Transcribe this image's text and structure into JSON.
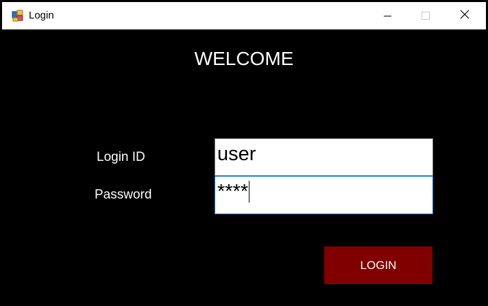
{
  "window": {
    "title": "Login",
    "icon": "windows-forms-app-icon",
    "controls": {
      "minimize_icon": "minimize-icon",
      "maximize_icon": "maximize-icon",
      "close_icon": "close-icon"
    }
  },
  "form": {
    "heading": "WELCOME",
    "login_id_label": "Login ID",
    "login_id_value": "user",
    "password_label": "Password",
    "password_value": "****",
    "login_button_label": "LOGIN"
  },
  "colors": {
    "background": "#000000",
    "button": "#800000",
    "focus_border": "#0078d7"
  }
}
